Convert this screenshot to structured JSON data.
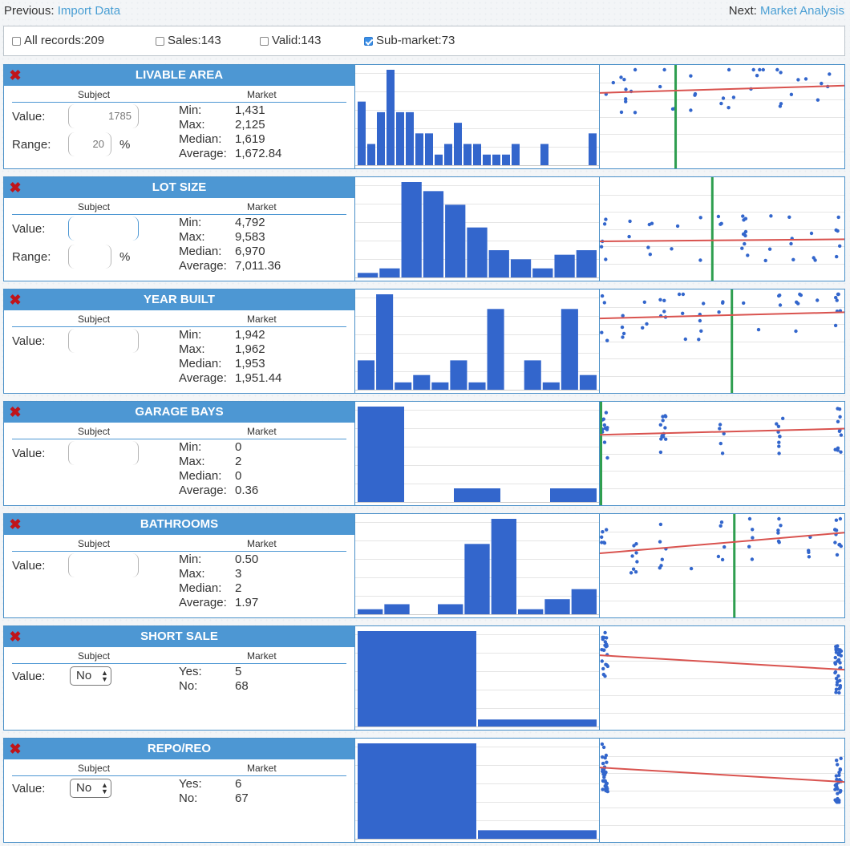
{
  "nav": {
    "prev_label": "Previous:",
    "prev_link": "Import Data",
    "next_label": "Next:",
    "next_link": "Market Analysis"
  },
  "filters": [
    {
      "label": "All records:209",
      "checked": false
    },
    {
      "label": "Sales:143",
      "checked": false
    },
    {
      "label": "Valid:143",
      "checked": false
    },
    {
      "label": "Sub-market:73",
      "checked": true
    }
  ],
  "colors": {
    "header": "#4d97d3",
    "bar": "#3366cc",
    "point": "#3366cc",
    "trend": "#d9534f",
    "subject_line": "#2e9e4f",
    "remove": "#c0141a"
  },
  "icons": {
    "remove": "close-x-icon",
    "select": "up-down-arrows-icon"
  },
  "labels": {
    "subject": "Subject",
    "market": "Market",
    "value": "Value:",
    "range": "Range:",
    "percent": "%"
  },
  "panels": [
    {
      "title": "LIVABLE AREA",
      "value": "1785",
      "range": "20",
      "stats": [
        [
          "Min:",
          "1,431"
        ],
        [
          "Max:",
          "2,125"
        ],
        [
          "Median:",
          "1,619"
        ],
        [
          "Average:",
          "1,672.84"
        ]
      ],
      "histogram": [
        6,
        2,
        5,
        9,
        5,
        5,
        3,
        3,
        1,
        2,
        4,
        2,
        2,
        1,
        1,
        1,
        2,
        0,
        0,
        2,
        0,
        0,
        0,
        0,
        3
      ],
      "subject_x": 0.31,
      "trend": [
        0.73,
        0.8
      ]
    },
    {
      "title": "LOT SIZE",
      "value": "",
      "range": "",
      "stats": [
        [
          "Min:",
          "4,792"
        ],
        [
          "Max:",
          "9,583"
        ],
        [
          "Median:",
          "6,970"
        ],
        [
          "Average:",
          "7,011.36"
        ]
      ],
      "histogram": [
        1,
        2,
        21,
        19,
        16,
        11,
        6,
        4,
        2,
        5,
        6
      ],
      "subject_x": 0.46,
      "trend": [
        0.38,
        0.4
      ]
    },
    {
      "title": "YEAR BUILT",
      "value": "",
      "stats": [
        [
          "Min:",
          "1,942"
        ],
        [
          "Max:",
          "1,962"
        ],
        [
          "Median:",
          "1,953"
        ],
        [
          "Average:",
          "1,951.44"
        ]
      ],
      "histogram": [
        4,
        13,
        1,
        2,
        1,
        4,
        1,
        11,
        0,
        4,
        1,
        11,
        2
      ],
      "subject_x": 0.54,
      "trend": [
        0.72,
        0.78
      ]
    },
    {
      "title": "GARAGE BAYS",
      "value": "",
      "stats": [
        [
          "Min:",
          "0"
        ],
        [
          "Max:",
          "2"
        ],
        [
          "Median:",
          "0"
        ],
        [
          "Average:",
          "0.36"
        ]
      ],
      "histogram": [
        7,
        0,
        1,
        0,
        1
      ],
      "subject_x": 0.005,
      "trend": [
        0.68,
        0.74
      ]
    },
    {
      "title": "BATHROOMS",
      "value": "",
      "stats": [
        [
          "Min:",
          "0.50"
        ],
        [
          "Max:",
          "3"
        ],
        [
          "Median:",
          "2"
        ],
        [
          "Average:",
          "1.97"
        ]
      ],
      "histogram": [
        1,
        2,
        0,
        2,
        14,
        19,
        1,
        3,
        5
      ],
      "subject_x": 0.55,
      "trend": [
        0.62,
        0.82
      ]
    },
    {
      "title": "SHORT SALE",
      "select_value": "No",
      "stats": [
        [
          "Yes:",
          "5"
        ],
        [
          "No:",
          "68"
        ]
      ],
      "histogram": [
        68,
        5
      ],
      "trend": [
        0.72,
        0.58
      ]
    },
    {
      "title": "REPO/REO",
      "select_value": "No",
      "stats": [
        [
          "Yes:",
          "6"
        ],
        [
          "No:",
          "67"
        ]
      ],
      "histogram": [
        67,
        6
      ],
      "trend": [
        0.72,
        0.58
      ]
    }
  ]
}
